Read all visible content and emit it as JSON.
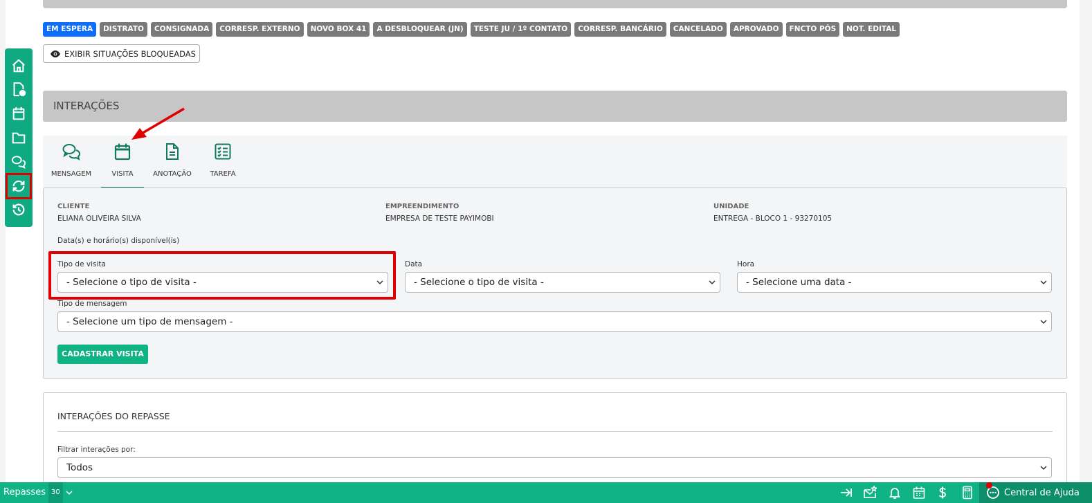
{
  "status_tags": [
    {
      "label": "EM ESPERA",
      "active": true
    },
    {
      "label": "DISTRATO",
      "active": false
    },
    {
      "label": "CONSIGNADA",
      "active": false
    },
    {
      "label": "CORRESP. EXTERNO",
      "active": false
    },
    {
      "label": "NOVO BOX 41",
      "active": false
    },
    {
      "label": "A DESBLOQUEAR (JN)",
      "active": false
    },
    {
      "label": "TESTE JU / 1º CONTATO",
      "active": false
    },
    {
      "label": "CORRESP. BANCÁRIO",
      "active": false
    },
    {
      "label": "CANCELADO",
      "active": false
    },
    {
      "label": "APROVADO",
      "active": false
    },
    {
      "label": "FNCTO PÓS",
      "active": false
    },
    {
      "label": "NOT. EDITAL",
      "active": false
    }
  ],
  "show_blocked_label": "EXIBIR SITUAÇÕES BLOQUEADAS",
  "interactions_title": "INTERAÇÕES",
  "tabs": [
    {
      "label": "MENSAGEM",
      "icon": "chat-icon"
    },
    {
      "label": "VISITA",
      "icon": "calendar-icon",
      "active": true
    },
    {
      "label": "ANOTAÇÃO",
      "icon": "document-icon"
    },
    {
      "label": "TAREFA",
      "icon": "checklist-icon"
    }
  ],
  "info": {
    "client_label": "CLIENTE",
    "client_value": "ELIANA OLIVEIRA SILVA",
    "enterprise_label": "EMPREENDIMENTO",
    "enterprise_value": "EMPRESA DE TESTE PAYIMOBI",
    "unit_label": "UNIDADE",
    "unit_value": "ENTREGA - BLOCO 1 - 93270105"
  },
  "available_dates_label": "Data(s) e horário(s) disponível(is)",
  "form": {
    "visit_type_label": "Tipo de visita",
    "visit_type_value": "- Selecione o tipo de visita -",
    "date_label": "Data",
    "date_value": "- Selecione o tipo de visita -",
    "hour_label": "Hora",
    "hour_value": "- Selecione uma data -",
    "message_type_label": "Tipo de mensagem",
    "message_type_value": "- Selecione um tipo de mensagem -",
    "submit_label": "CADASTRAR VISITA"
  },
  "repasse_panel": {
    "title": "INTERAÇÕES DO REPASSE",
    "filter_label": "Filtrar interações por:",
    "filter_value": "Todos"
  },
  "bottom_bar": {
    "module": "Repasses",
    "count": "30",
    "help_label": "Central de Ajuda"
  },
  "colors": {
    "brand_green": "#0fb386",
    "sidebar_green": "#0faa82",
    "icon_green": "#0f7a5e",
    "highlight_red": "#e10000",
    "active_tag_blue": "#0d6efd",
    "tag_grey": "#7a7a7a"
  }
}
